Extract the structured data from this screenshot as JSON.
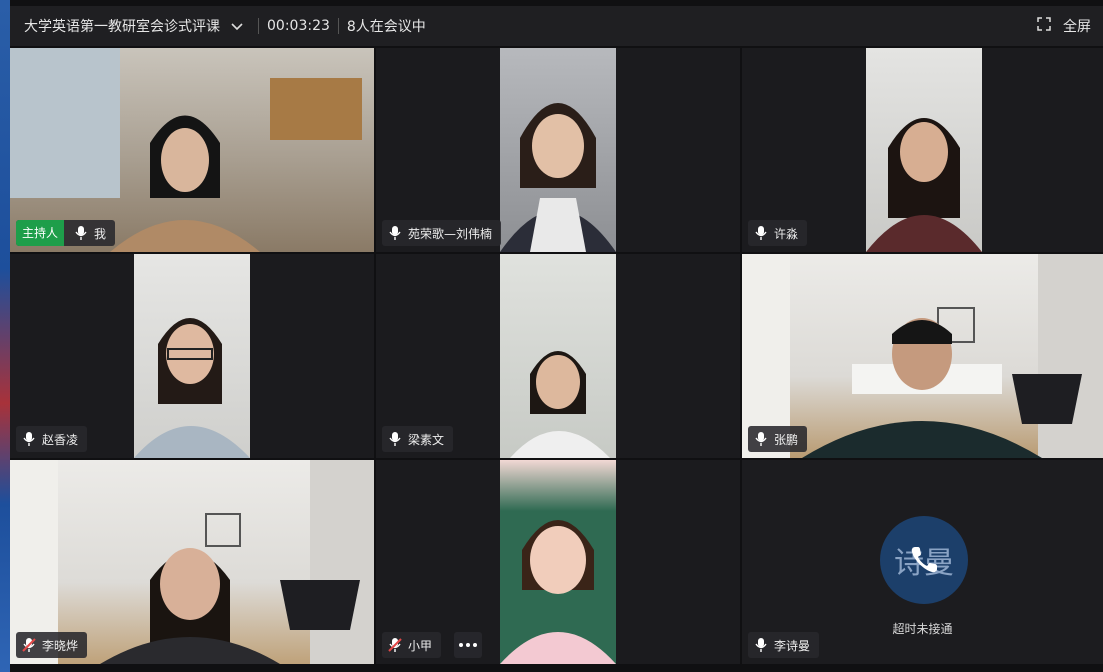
{
  "meeting": {
    "title": "大学英语第一教研室会诊式评课",
    "duration": "00:03:23",
    "participants_count": "8人在会议中",
    "fullscreen_label": "全屏"
  },
  "tiles": [
    {
      "name": "我",
      "host_badge": "主持人",
      "mic": "on",
      "video_bg": "#9a8e80"
    },
    {
      "name": "苑荣歌—刘伟楠",
      "mic": "on",
      "video_bg": "#8c8e94"
    },
    {
      "name": "许淼",
      "mic": "on",
      "video_bg": "#d5d5d3"
    },
    {
      "name": "赵香凌",
      "mic": "on",
      "video_bg": "#d9dad8"
    },
    {
      "name": "梁素文",
      "mic": "on",
      "video_bg": "#dadcd8"
    },
    {
      "name": "张鹏",
      "mic": "on",
      "video_bg": "#e4e2df"
    },
    {
      "name": "李晓烨",
      "mic": "muted",
      "video_bg": "#e2e0dc"
    },
    {
      "name": "小甲",
      "mic": "muted",
      "video_bg": "#2f6a52"
    },
    {
      "name": "李诗曼",
      "mic": "on",
      "avatar_text": "诗曼",
      "status": "超时未接通"
    }
  ],
  "colors": {
    "host_badge": "#1e9e4a",
    "avatar_bg": "#1c3f6a",
    "muted_red": "#e34848"
  }
}
